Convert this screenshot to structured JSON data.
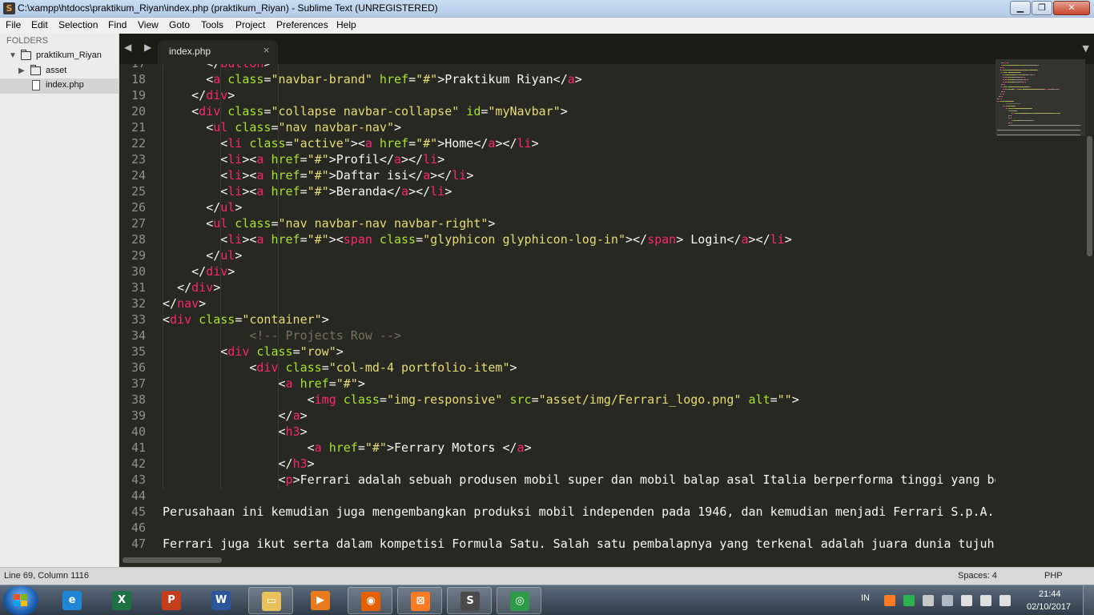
{
  "window": {
    "title": "C:\\xampp\\htdocs\\praktikum_Riyan\\index.php (praktikum_Riyan) - Sublime Text (UNREGISTERED)",
    "min_glyph": "▁",
    "max_glyph": "❐",
    "close_glyph": "✕"
  },
  "menu": [
    "File",
    "Edit",
    "Selection",
    "Find",
    "View",
    "Goto",
    "Tools",
    "Project",
    "Preferences",
    "Help"
  ],
  "sidebar": {
    "header": "FOLDERS",
    "root": "praktikum_Riyan",
    "folder": "asset",
    "file": "index.php"
  },
  "tabs": {
    "nav_glyph": "◀ ▶",
    "active_label": "index.php",
    "close_glyph": "×",
    "menu_glyph": "▼"
  },
  "editor": {
    "line_numbers": [
      "17",
      "18",
      "19",
      "20",
      "21",
      "22",
      "23",
      "24",
      "25",
      "26",
      "27",
      "28",
      "29",
      "30",
      "31",
      "32",
      "33",
      "34",
      "35",
      "36",
      "37",
      "38",
      "39",
      "40",
      "41",
      "42",
      "43",
      "44",
      "45",
      "46",
      "47"
    ],
    "lines": [
      {
        "indent": "      ",
        "tokens": [
          [
            "p",
            "</"
          ],
          [
            "t",
            "button"
          ],
          [
            "p",
            ">"
          ]
        ]
      },
      {
        "indent": "      ",
        "tokens": [
          [
            "p",
            "<"
          ],
          [
            "t",
            "a"
          ],
          [
            "a",
            " class"
          ],
          [
            "p",
            "="
          ],
          [
            "s",
            "\"navbar-brand\""
          ],
          [
            "a",
            " href"
          ],
          [
            "p",
            "="
          ],
          [
            "s",
            "\"#\""
          ],
          [
            "p",
            ">Praktikum Riyan</"
          ],
          [
            "t",
            "a"
          ],
          [
            "p",
            ">"
          ]
        ]
      },
      {
        "indent": "    ",
        "tokens": [
          [
            "p",
            "</"
          ],
          [
            "t",
            "div"
          ],
          [
            "p",
            ">"
          ]
        ]
      },
      {
        "indent": "    ",
        "tokens": [
          [
            "p",
            "<"
          ],
          [
            "t",
            "div"
          ],
          [
            "a",
            " class"
          ],
          [
            "p",
            "="
          ],
          [
            "s",
            "\"collapse navbar-collapse\""
          ],
          [
            "a",
            " id"
          ],
          [
            "p",
            "="
          ],
          [
            "s",
            "\"myNavbar\""
          ],
          [
            "p",
            ">"
          ]
        ]
      },
      {
        "indent": "      ",
        "tokens": [
          [
            "p",
            "<"
          ],
          [
            "t",
            "ul"
          ],
          [
            "a",
            " class"
          ],
          [
            "p",
            "="
          ],
          [
            "s",
            "\"nav navbar-nav\""
          ],
          [
            "p",
            ">"
          ]
        ]
      },
      {
        "indent": "        ",
        "tokens": [
          [
            "p",
            "<"
          ],
          [
            "t",
            "li"
          ],
          [
            "a",
            " class"
          ],
          [
            "p",
            "="
          ],
          [
            "s",
            "\"active\""
          ],
          [
            "p",
            "><"
          ],
          [
            "t",
            "a"
          ],
          [
            "a",
            " href"
          ],
          [
            "p",
            "="
          ],
          [
            "s",
            "\"#\""
          ],
          [
            "p",
            ">Home</"
          ],
          [
            "t",
            "a"
          ],
          [
            "p",
            "></"
          ],
          [
            "t",
            "li"
          ],
          [
            "p",
            ">"
          ]
        ]
      },
      {
        "indent": "        ",
        "tokens": [
          [
            "p",
            "<"
          ],
          [
            "t",
            "li"
          ],
          [
            "p",
            "><"
          ],
          [
            "t",
            "a"
          ],
          [
            "a",
            " href"
          ],
          [
            "p",
            "="
          ],
          [
            "s",
            "\"#\""
          ],
          [
            "p",
            ">Profil</"
          ],
          [
            "t",
            "a"
          ],
          [
            "p",
            "></"
          ],
          [
            "t",
            "li"
          ],
          [
            "p",
            ">"
          ]
        ]
      },
      {
        "indent": "        ",
        "tokens": [
          [
            "p",
            "<"
          ],
          [
            "t",
            "li"
          ],
          [
            "p",
            "><"
          ],
          [
            "t",
            "a"
          ],
          [
            "a",
            " href"
          ],
          [
            "p",
            "="
          ],
          [
            "s",
            "\"#\""
          ],
          [
            "p",
            ">Daftar isi</"
          ],
          [
            "t",
            "a"
          ],
          [
            "p",
            "></"
          ],
          [
            "t",
            "li"
          ],
          [
            "p",
            ">"
          ]
        ]
      },
      {
        "indent": "        ",
        "tokens": [
          [
            "p",
            "<"
          ],
          [
            "t",
            "li"
          ],
          [
            "p",
            "><"
          ],
          [
            "t",
            "a"
          ],
          [
            "a",
            " href"
          ],
          [
            "p",
            "="
          ],
          [
            "s",
            "\"#\""
          ],
          [
            "p",
            ">Beranda</"
          ],
          [
            "t",
            "a"
          ],
          [
            "p",
            "></"
          ],
          [
            "t",
            "li"
          ],
          [
            "p",
            ">"
          ]
        ]
      },
      {
        "indent": "      ",
        "tokens": [
          [
            "p",
            "</"
          ],
          [
            "t",
            "ul"
          ],
          [
            "p",
            ">"
          ]
        ]
      },
      {
        "indent": "      ",
        "tokens": [
          [
            "p",
            "<"
          ],
          [
            "t",
            "ul"
          ],
          [
            "a",
            " class"
          ],
          [
            "p",
            "="
          ],
          [
            "s",
            "\"nav navbar-nav navbar-right\""
          ],
          [
            "p",
            ">"
          ]
        ]
      },
      {
        "indent": "        ",
        "tokens": [
          [
            "p",
            "<"
          ],
          [
            "t",
            "li"
          ],
          [
            "p",
            "><"
          ],
          [
            "t",
            "a"
          ],
          [
            "a",
            " href"
          ],
          [
            "p",
            "="
          ],
          [
            "s",
            "\"#\""
          ],
          [
            "p",
            "><"
          ],
          [
            "t",
            "span"
          ],
          [
            "a",
            " class"
          ],
          [
            "p",
            "="
          ],
          [
            "s",
            "\"glyphicon glyphicon-log-in\""
          ],
          [
            "p",
            "></"
          ],
          [
            "t",
            "span"
          ],
          [
            "p",
            "> Login</"
          ],
          [
            "t",
            "a"
          ],
          [
            "p",
            "></"
          ],
          [
            "t",
            "li"
          ],
          [
            "p",
            ">"
          ]
        ]
      },
      {
        "indent": "      ",
        "tokens": [
          [
            "p",
            "</"
          ],
          [
            "t",
            "ul"
          ],
          [
            "p",
            ">"
          ]
        ]
      },
      {
        "indent": "    ",
        "tokens": [
          [
            "p",
            "</"
          ],
          [
            "t",
            "div"
          ],
          [
            "p",
            ">"
          ]
        ]
      },
      {
        "indent": "  ",
        "tokens": [
          [
            "p",
            "</"
          ],
          [
            "t",
            "div"
          ],
          [
            "p",
            ">"
          ]
        ]
      },
      {
        "indent": "",
        "tokens": [
          [
            "p",
            "</"
          ],
          [
            "t",
            "nav"
          ],
          [
            "p",
            ">"
          ]
        ]
      },
      {
        "indent": "",
        "tokens": [
          [
            "p",
            "<"
          ],
          [
            "t",
            "div"
          ],
          [
            "a",
            " class"
          ],
          [
            "p",
            "="
          ],
          [
            "s",
            "\"container\""
          ],
          [
            "p",
            ">"
          ]
        ]
      },
      {
        "indent": "            ",
        "tokens": [
          [
            "c",
            "<!-- Projects Row -->"
          ]
        ]
      },
      {
        "indent": "        ",
        "tokens": [
          [
            "p",
            "<"
          ],
          [
            "t",
            "div"
          ],
          [
            "a",
            " class"
          ],
          [
            "p",
            "="
          ],
          [
            "s",
            "\"row\""
          ],
          [
            "p",
            ">"
          ]
        ]
      },
      {
        "indent": "            ",
        "tokens": [
          [
            "p",
            "<"
          ],
          [
            "t",
            "div"
          ],
          [
            "a",
            " class"
          ],
          [
            "p",
            "="
          ],
          [
            "s",
            "\"col-md-4 portfolio-item\""
          ],
          [
            "p",
            ">"
          ]
        ]
      },
      {
        "indent": "                ",
        "tokens": [
          [
            "p",
            "<"
          ],
          [
            "t",
            "a"
          ],
          [
            "a",
            " href"
          ],
          [
            "p",
            "="
          ],
          [
            "s",
            "\"#\""
          ],
          [
            "p",
            ">"
          ]
        ]
      },
      {
        "indent": "                    ",
        "tokens": [
          [
            "p",
            "<"
          ],
          [
            "t",
            "img"
          ],
          [
            "a",
            " class"
          ],
          [
            "p",
            "="
          ],
          [
            "s",
            "\"img-responsive\""
          ],
          [
            "a",
            " src"
          ],
          [
            "p",
            "="
          ],
          [
            "s",
            "\"asset/img/Ferrari_logo.png\""
          ],
          [
            "a",
            " alt"
          ],
          [
            "p",
            "="
          ],
          [
            "s",
            "\"\""
          ],
          [
            "p",
            ">"
          ]
        ]
      },
      {
        "indent": "                ",
        "tokens": [
          [
            "p",
            "</"
          ],
          [
            "t",
            "a"
          ],
          [
            "p",
            ">"
          ]
        ]
      },
      {
        "indent": "                ",
        "tokens": [
          [
            "p",
            "<"
          ],
          [
            "t",
            "h3"
          ],
          [
            "p",
            ">"
          ]
        ]
      },
      {
        "indent": "                    ",
        "tokens": [
          [
            "p",
            "<"
          ],
          [
            "t",
            "a"
          ],
          [
            "a",
            " href"
          ],
          [
            "p",
            "="
          ],
          [
            "s",
            "\"#\""
          ],
          [
            "p",
            ">Ferrary Motors </"
          ],
          [
            "t",
            "a"
          ],
          [
            "p",
            ">"
          ]
        ]
      },
      {
        "indent": "                ",
        "tokens": [
          [
            "p",
            "</"
          ],
          [
            "t",
            "h3"
          ],
          [
            "p",
            ">"
          ]
        ]
      },
      {
        "indent": "                ",
        "tokens": [
          [
            "p",
            "<"
          ],
          [
            "t",
            "p"
          ],
          [
            "p",
            ">Ferrari adalah sebuah produsen mobil super dan mobil balap asal Italia berperforma tinggi yang be"
          ]
        ]
      },
      {
        "indent": "",
        "tokens": []
      },
      {
        "indent": "",
        "tokens": [
          [
            "p",
            "Perusahaan ini kemudian juga mengembangkan produksi mobil independen pada 1946, dan kemudian menjadi Ferrari S.p.A.,"
          ]
        ]
      },
      {
        "indent": "",
        "tokens": []
      },
      {
        "indent": "",
        "tokens": [
          [
            "p",
            "Ferrari juga ikut serta dalam kompetisi Formula Satu. Salah satu pembalapnya yang terkenal adalah juara dunia tujuh"
          ]
        ]
      }
    ]
  },
  "status": {
    "position": "Line 69, Column 1116",
    "spaces": "Spaces: 4",
    "syntax": "PHP"
  },
  "taskbar": {
    "apps": [
      {
        "name": "internet-explorer",
        "glyph": "e",
        "color": "#1f86d6",
        "open": false
      },
      {
        "name": "excel",
        "glyph": "X",
        "color": "#1e7145",
        "open": false
      },
      {
        "name": "powerpoint",
        "glyph": "P",
        "color": "#c43e1c",
        "open": false
      },
      {
        "name": "word",
        "glyph": "W",
        "color": "#2b579a",
        "open": false
      },
      {
        "name": "explorer",
        "glyph": "▭",
        "color": "#e8c15a",
        "open": true
      },
      {
        "name": "media-player",
        "glyph": "▶",
        "color": "#e77b1e",
        "open": false
      },
      {
        "name": "firefox",
        "glyph": "◉",
        "color": "#e66000",
        "open": true
      },
      {
        "name": "xampp",
        "glyph": "⊠",
        "color": "#fb7a24",
        "open": true
      },
      {
        "name": "sublime-text",
        "glyph": "S",
        "color": "#4a4a4a",
        "open": true
      },
      {
        "name": "chrome",
        "glyph": "◎",
        "color": "#2d9a47",
        "open": true
      }
    ],
    "lang": "IN",
    "time": "21:44",
    "date": "02/10/2017",
    "tray_icons": [
      {
        "name": "xampp-tray-icon",
        "color": "#fb7a24"
      },
      {
        "name": "triangle-tray-icon",
        "color": "#2bb24c"
      },
      {
        "name": "flag-tray-icon",
        "color": "#c8c8c8"
      },
      {
        "name": "display-tray-icon",
        "color": "#b0b8c4"
      },
      {
        "name": "battery-tray-icon",
        "color": "#e0e0e0"
      },
      {
        "name": "signal-tray-icon",
        "color": "#e0e0e0"
      },
      {
        "name": "volume-tray-icon",
        "color": "#e0e0e0"
      }
    ]
  }
}
